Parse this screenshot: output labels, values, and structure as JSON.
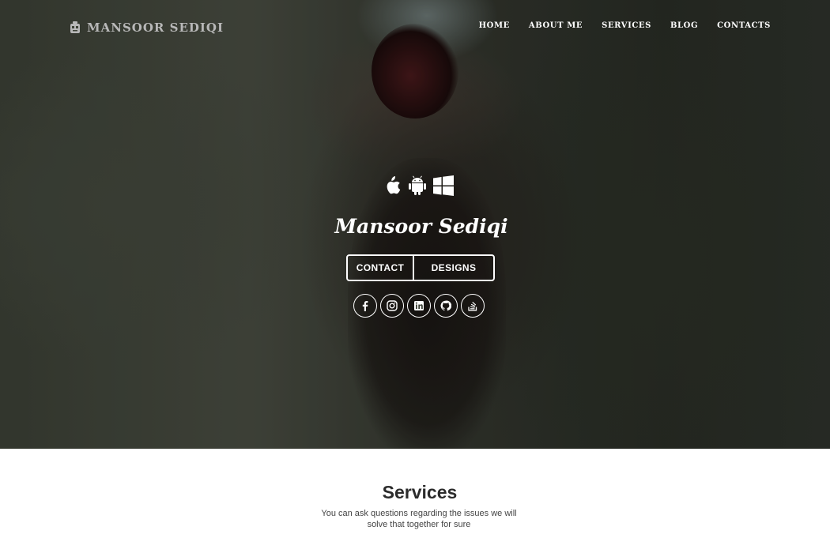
{
  "header": {
    "brand": "MANSOOR SEDIQI",
    "brand_icon": "robot-icon",
    "nav": [
      {
        "label": "HOME"
      },
      {
        "label": "ABOUT ME"
      },
      {
        "label": "SERVICES"
      },
      {
        "label": "BLOG"
      },
      {
        "label": "CONTACTS"
      }
    ]
  },
  "hero": {
    "platform_icons": [
      "apple-icon",
      "android-icon",
      "windows-icon"
    ],
    "title": "Mansoor Sediqi",
    "buttons": {
      "contact": "CONTACT",
      "designs": "DESIGNS"
    },
    "social_icons": [
      "facebook-icon",
      "instagram-icon",
      "linkedin-icon",
      "github-icon",
      "stackoverflow-icon"
    ]
  },
  "services": {
    "title": "Services",
    "description": "You can ask questions regarding the issues we will solve that together for sure"
  },
  "colors": {
    "text_light": "#ffffff",
    "brand_gray": "#b8b8b8",
    "heading_dark": "#2b2b2b"
  }
}
